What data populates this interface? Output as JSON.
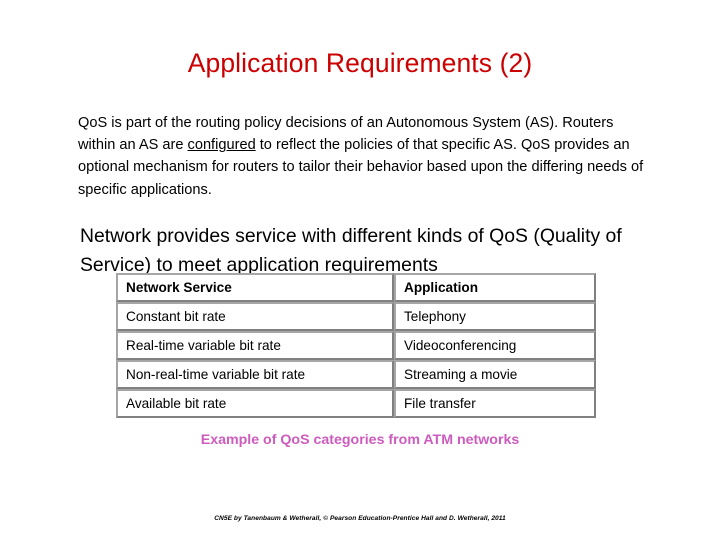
{
  "slide": {
    "title": "Application Requirements (2)",
    "title_color": "#CC0000",
    "background_color": "#FFFFFF",
    "paragraph1": {
      "part_a": "QoS is part of the routing policy decisions of an Autonomous System (AS). Routers within an AS are ",
      "emphasis": "configured",
      "part_b": " to reflect the policies of that specific AS. QoS provides an optional mechanism for routers to tailor their behavior based upon the differing needs of specific applications."
    },
    "paragraph2": "Network provides service with different kinds of QoS (Quality of Service) to meet application requirements",
    "table": {
      "headers": [
        "Network Service",
        "Application"
      ],
      "rows": [
        [
          "Constant bit rate",
          "Telephony"
        ],
        [
          "Real-time variable bit rate",
          "Videoconferencing"
        ],
        [
          "Non-real-time variable bit rate",
          "Streaming a movie"
        ],
        [
          "Available bit rate",
          "File transfer"
        ]
      ],
      "border_color": "#8C8C8C"
    },
    "caption": "Example of QoS categories from ATM networks",
    "caption_color": "#CE5BBE",
    "footer_credit": "CN5E by Tanenbaum  & Wetherall, © Pearson Education-Prentice Hall and D. Wetherall, 2011"
  }
}
